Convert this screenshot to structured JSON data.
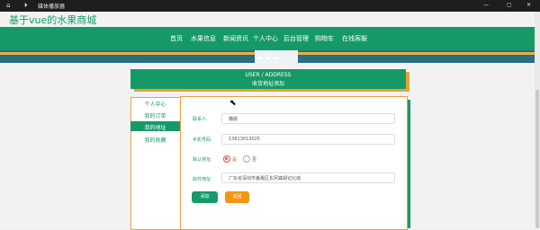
{
  "window": {
    "title": "媒体播放器",
    "controls": {
      "minimize": "minimize-icon",
      "maximize": "maximize-icon",
      "close": "close-icon"
    }
  },
  "site": {
    "title": "基于vue的水果商城",
    "brand_color": "#159a67",
    "accent_color": "#e3a52a"
  },
  "nav": {
    "items": [
      "首页",
      "水果信息",
      "新闻资讯",
      "个人中心",
      "后台管理",
      "购物车",
      "在线客服"
    ]
  },
  "header": {
    "en": "USER / ADDRESS",
    "zh": "收货地址添加"
  },
  "sidebar": {
    "items": [
      "个人中心",
      "我的订单",
      "我的地址",
      "我的收藏"
    ],
    "active_index": 2
  },
  "form": {
    "fields": [
      {
        "label": "联系人",
        "value": "魏晨"
      },
      {
        "label": "手机号码",
        "value": "13613013025"
      },
      {
        "label": "默认地址",
        "options": [
          "是",
          "否"
        ],
        "selected": "是"
      },
      {
        "label": "收件地址",
        "value": "广东省深圳市番禺区东风镇胡记北城"
      }
    ],
    "buttons": {
      "add": "添加",
      "back": "返回"
    }
  }
}
